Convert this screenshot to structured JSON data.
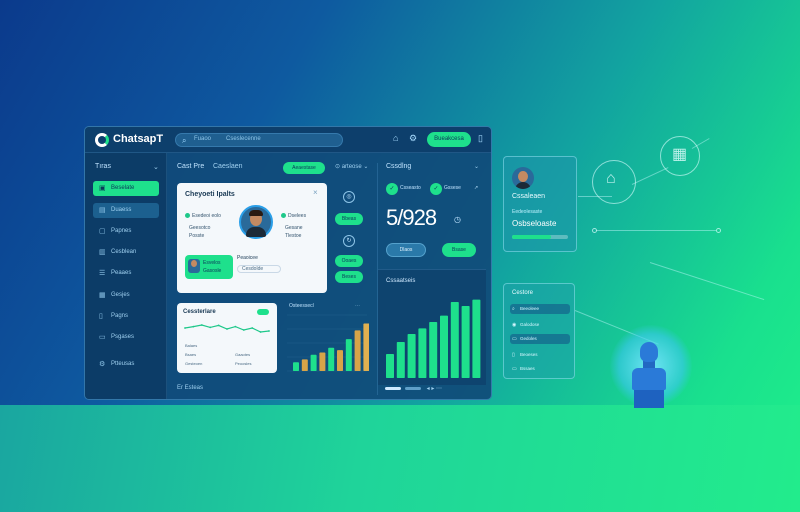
{
  "topbar": {
    "brand": "ChatsapT",
    "search_a": "Fuaoo",
    "search_b": "Cseslecenne",
    "action_label": "Bueakcesa"
  },
  "sidebar": {
    "heading": "Tıras",
    "items": [
      {
        "label": "Beselate",
        "icon": "grid-icon"
      },
      {
        "label": "Duaess",
        "icon": "doc-icon"
      },
      {
        "label": "Papnes",
        "icon": "page-icon"
      },
      {
        "label": "Cesblean",
        "icon": "chart-icon"
      },
      {
        "label": "Peaaes",
        "icon": "list-icon"
      },
      {
        "label": "Gesjes",
        "icon": "calendar-icon"
      },
      {
        "label": "Pagns",
        "icon": "file-icon"
      },
      {
        "label": "Psgases",
        "icon": "folder-icon"
      },
      {
        "label": "Ptteusas",
        "icon": "settings-icon"
      }
    ]
  },
  "main": {
    "tab_1": "Cast Pre",
    "tab_2": "Caeslaen",
    "filter_btn": "Aeaestase",
    "select_label": "arteose"
  },
  "profile_card": {
    "title": "Cheyoeti Ipalts",
    "left_name": "Esedeoi eolo",
    "left_line_1": "Geesotco",
    "left_line_2": "Posste",
    "right_name": "Dselees",
    "right_line_1": "Gesane",
    "right_line_2": "Tlestoe",
    "green_line_1": "Esvelos",
    "green_line_2": "Gasosle",
    "mid_label": "Peaoicee",
    "mid_field": "Cesdolde"
  },
  "side_col": {
    "btn_1": "Bbeas",
    "btn_2": "Ooaes",
    "btn_3": "Beses"
  },
  "line_card": {
    "title": "Cessterlare",
    "legend": [
      "Balaes",
      "Bsaes",
      "Gesteoen",
      "Gaaotes",
      "Peoosles"
    ],
    "points": [
      0.55,
      0.62,
      0.7,
      0.58,
      0.68,
      0.5,
      0.62,
      0.45,
      0.55,
      0.35,
      0.4
    ]
  },
  "bars_small": {
    "title": "Osteessecl",
    "values": [
      0.15,
      0.2,
      0.28,
      0.32,
      0.4,
      0.36,
      0.55,
      0.7,
      0.82
    ],
    "colors": [
      "#1ee08c",
      "#d7a448",
      "#1ee08c",
      "#d7a448",
      "#1ee08c",
      "#d7a448",
      "#1ee08c",
      "#d7a448",
      "#e0b050"
    ]
  },
  "right_panel": {
    "title": "Cssdlng",
    "mini_a": "Csseasto",
    "mini_b": "Gssese",
    "big_number": "5/928",
    "btn_1": "Dlaos",
    "btn_2": "Bsase",
    "bar_title": "Cssaatseis",
    "bar_values": [
      0.3,
      0.45,
      0.55,
      0.62,
      0.7,
      0.78,
      0.95,
      0.9,
      0.98
    ]
  },
  "footer": {
    "left": "Er Esteas"
  },
  "float_profile": {
    "name": "Cssaleaen",
    "sub": "Eedeolesaste",
    "big": "Osbseloaste",
    "progress": 0.7
  },
  "float_list": {
    "title": "Cestore",
    "rows": [
      "Beeoleee",
      "Galodose",
      "Gedoles",
      "Beoeses",
      "Bssaes"
    ]
  },
  "colors": {
    "accent": "#1ee08c",
    "panel": "#104a78",
    "card": "#f4f8fb"
  }
}
